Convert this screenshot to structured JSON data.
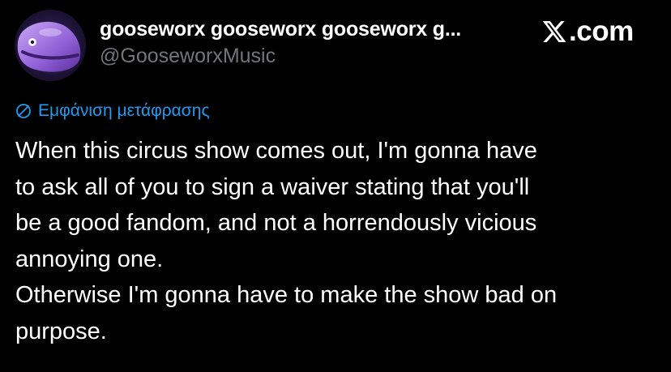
{
  "author": {
    "display_name": "gooseworx gooseworx gooseworx g...",
    "handle": "@GooseworxMusic",
    "avatar_icon": "purple-creature-avatar"
  },
  "brand": {
    "icon": "x-logo-icon",
    "text": ".com"
  },
  "translate": {
    "icon": "globe-translate-icon",
    "label": "Εμφάνιση μετάφρασης",
    "color": "#1d9bf0"
  },
  "tweet": {
    "lines": [
      "When this circus show comes out, I'm gonna have",
      "to ask all of you to sign a waiver stating that you'll",
      "be a good fandom, and not a horrendously vicious",
      "annoying one.",
      "Otherwise I'm gonna have to make the show bad on",
      "purpose."
    ]
  },
  "colors": {
    "background": "#000000",
    "text": "#ffffff",
    "secondary_text": "#71767b",
    "accent": "#1d9bf0"
  }
}
